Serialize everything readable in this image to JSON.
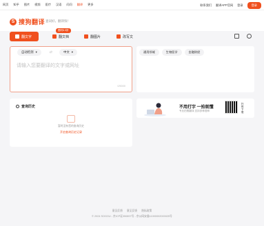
{
  "topnav": {
    "items": [
      "网页",
      "知乎",
      "图片",
      "视频",
      "医疗",
      "汉语",
      "问问",
      "翻译",
      "更多"
    ],
    "active_index": 7,
    "right": [
      "联系我们",
      "翻译APP官网",
      "登录"
    ],
    "login_label": "登录"
  },
  "header": {
    "logo_text": "搜狗翻译",
    "slogan": "查词好，翻译快！"
  },
  "tabs": {
    "text": "翻文字",
    "doc": "翻文档",
    "pic": "翻图片",
    "write": "改写文",
    "promo_badge": "限时8.5折"
  },
  "source": {
    "from_lang": "自动检测",
    "to_lang": "中文",
    "placeholder": "请输入您要翻译的文字或网址",
    "counter": "0/5000"
  },
  "target": {
    "domains": [
      "通用领域",
      "生物医学",
      "金融财经"
    ]
  },
  "history": {
    "title": "查询历史",
    "empty_text": "暂时没有您的查询历史",
    "empty_link": "开启查询历史记录"
  },
  "ad": {
    "headline": "不用打字 一拍就懂",
    "sub": "专业拍照翻译 支持多种语种",
    "qr_label": "扫码下载"
  },
  "footer": {
    "links": [
      "意见反馈",
      "意见反馈",
      "隐私政策"
    ],
    "copyright": "© 2024 SOGOU - 京ICP证050897号 - 京公网安备11000002000025号"
  },
  "colors": {
    "accent": "#f0501e",
    "background": "#f5f5f7"
  }
}
